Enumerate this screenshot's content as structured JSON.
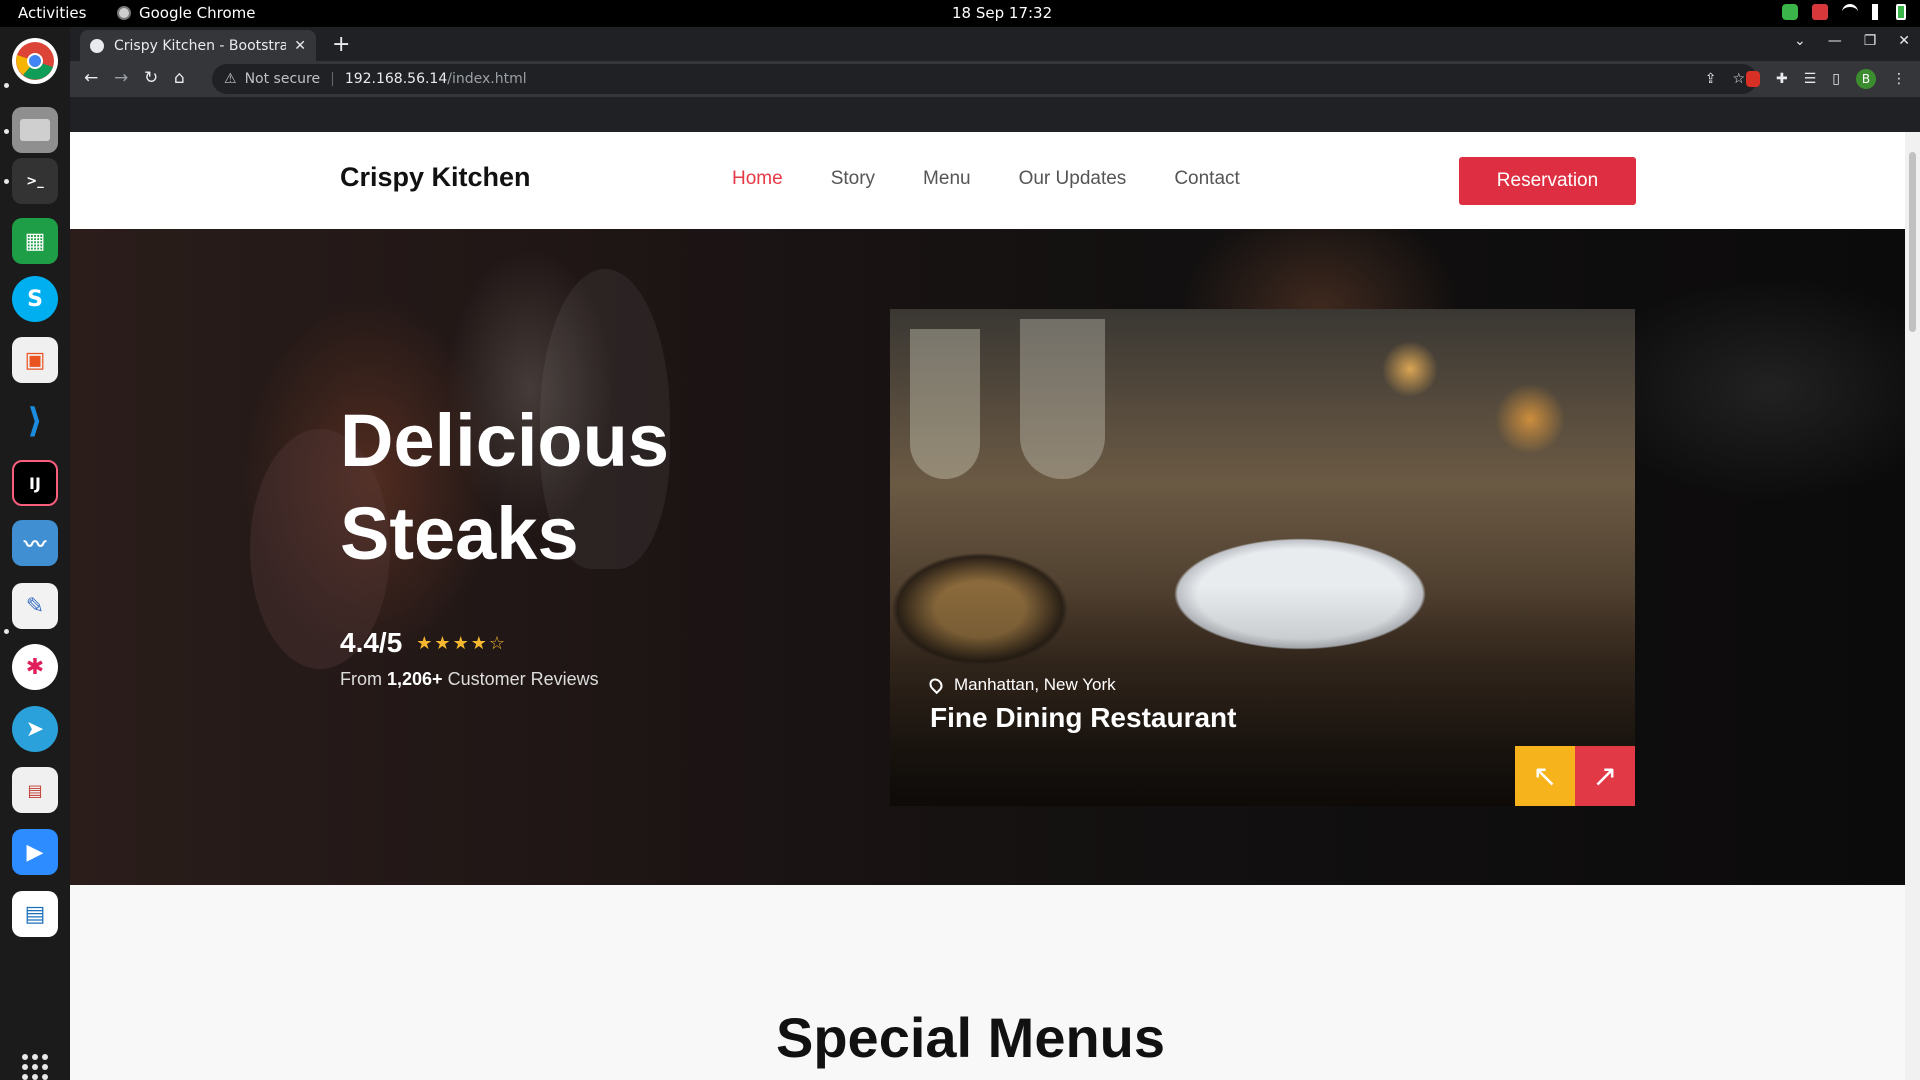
{
  "system": {
    "activities": "Activities",
    "app_name": "Google Chrome",
    "clock": "18 Sep  17:32"
  },
  "browser": {
    "tab_title": "Crispy Kitchen - Bootstrap",
    "new_tab_symbol": "+",
    "not_secure": "Not secure",
    "url_host": "192.168.56.14",
    "url_path": "/index.html",
    "avatar_letter": "B"
  },
  "site": {
    "brand": "Crispy Kitchen",
    "nav": [
      {
        "label": "Home",
        "active": true
      },
      {
        "label": "Story"
      },
      {
        "label": "Menu"
      },
      {
        "label": "Our Updates"
      },
      {
        "label": "Contact"
      }
    ],
    "reservation_label": "Reservation"
  },
  "hero": {
    "title_line1": "Delicious",
    "title_line2": "Steaks",
    "rating_score": "4.4/5",
    "rating_stars": 4,
    "reviews_prefix": "From",
    "reviews_count": "1,206+",
    "reviews_suffix": "Customer Reviews",
    "slide": {
      "location": "Manhattan, New York",
      "title": "Fine Dining Restaurant"
    }
  },
  "section": {
    "title": "Special Menus"
  },
  "colors": {
    "accent_red": "#de2f42",
    "accent_yellow": "#f6b31b",
    "star": "#f5b82e"
  }
}
